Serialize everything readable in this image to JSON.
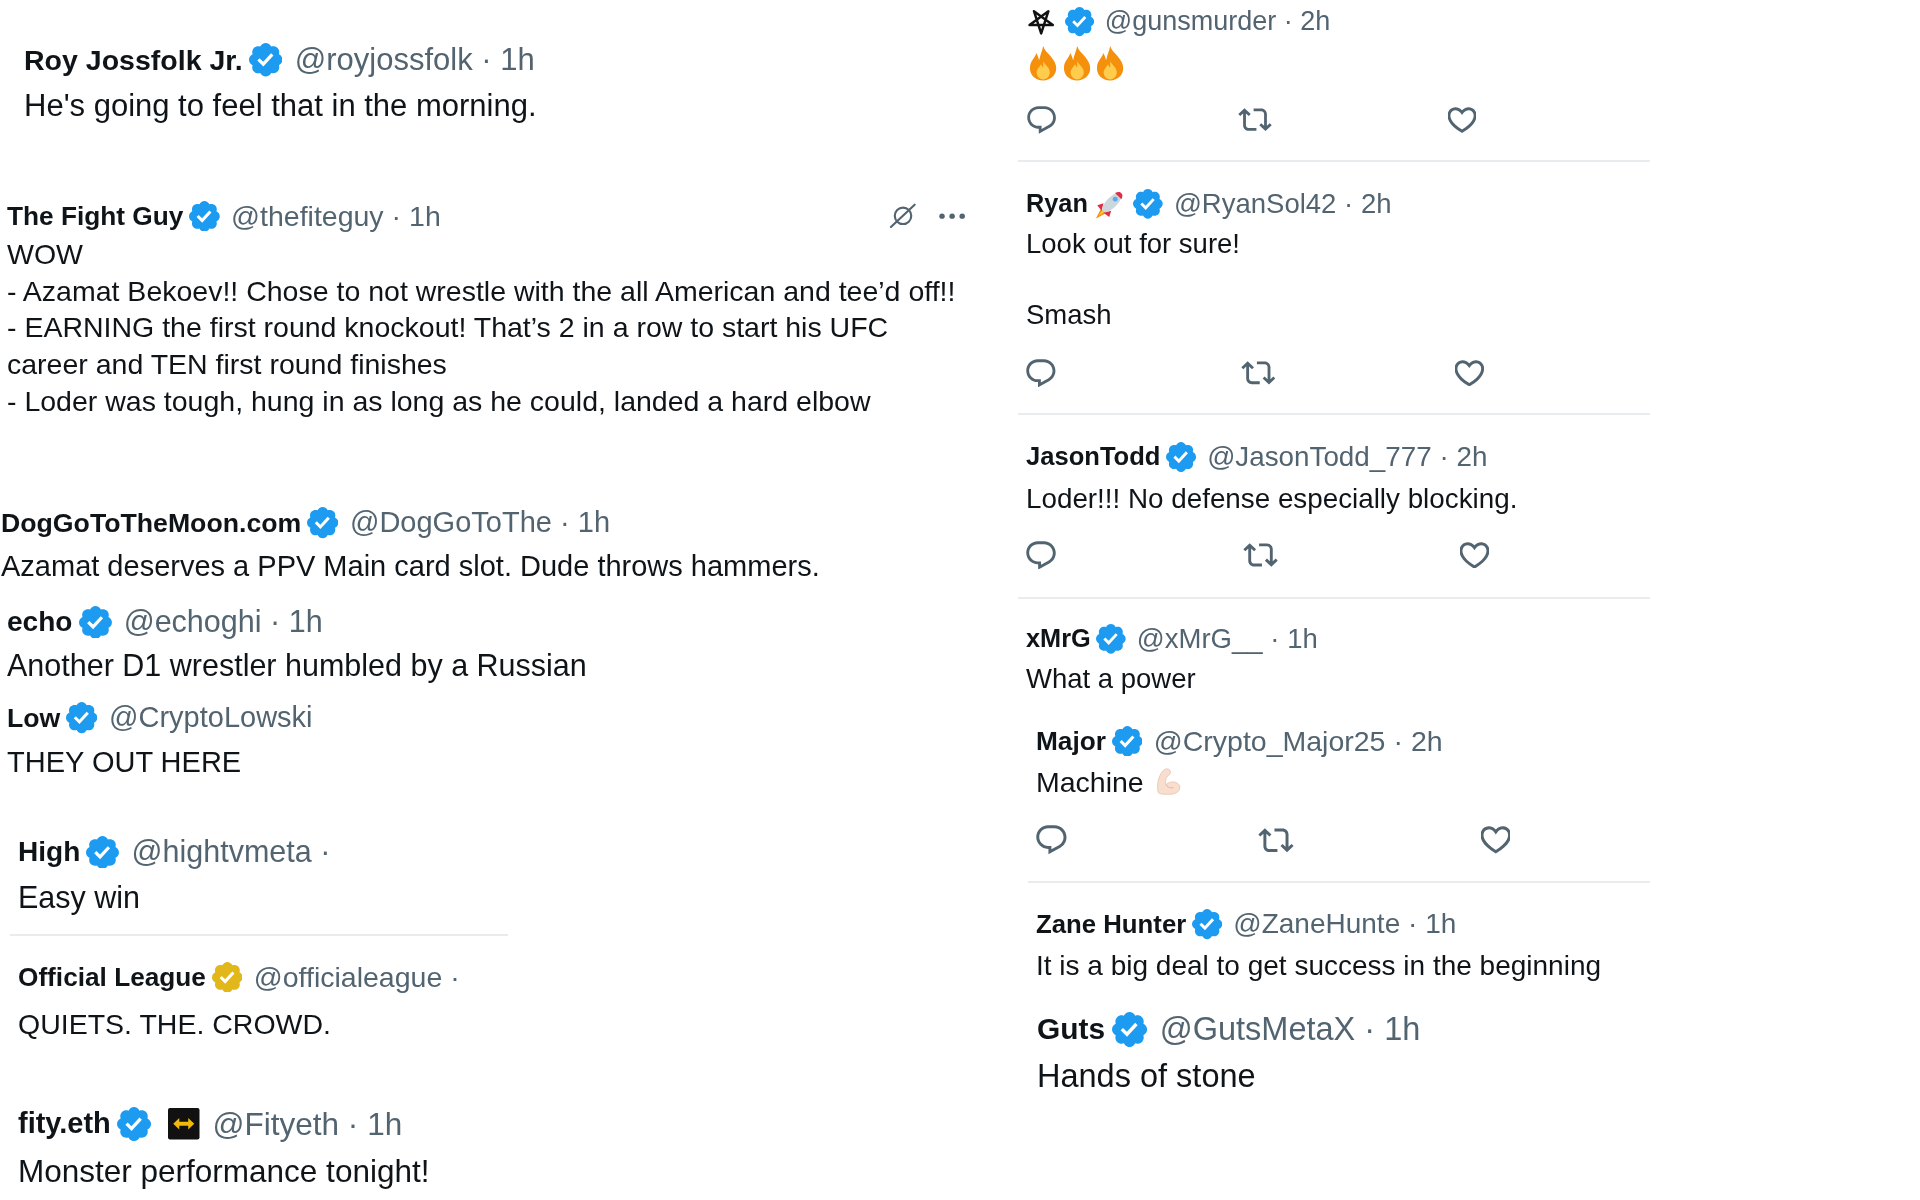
{
  "left_column": {
    "posts": [
      {
        "name": "Roy Jossfolk Jr.",
        "name_icons": [
          {
            "kind": "verified",
            "color": "#1d9bf0"
          }
        ],
        "handle": "@royjossfolk",
        "separator": "·",
        "time": "1h",
        "text": "He's going to feel that in the morning."
      },
      {
        "name": "The Fight Guy",
        "name_icons": [
          {
            "kind": "verified",
            "color": "#1d9bf0"
          }
        ],
        "handle": "@thefiteguy",
        "separator": "·",
        "time": "1h",
        "tools": [
          {
            "kind": "explain"
          },
          {
            "kind": "more"
          }
        ],
        "text": "WOW\n- Azamat Bekoev!! Chose to not wrestle with the all American and tee’d off!!\n- EARNING the first round knockout! That’s 2 in a row to start his UFC career and TEN first round finishes\n- Loder was tough, hung in as long as he could, landed a hard elbow"
      },
      {
        "name": "DogGoToTheMoon.com",
        "name_icons": [
          {
            "kind": "verified",
            "color": "#1d9bf0"
          }
        ],
        "handle": "@DogGoToThe",
        "separator": "·",
        "time": "1h",
        "text": "Azamat deserves a PPV Main card slot. Dude throws hammers."
      },
      {
        "name": "echo",
        "name_icons": [
          {
            "kind": "verified",
            "color": "#1d9bf0"
          }
        ],
        "handle": "@echoghi",
        "separator": "·",
        "time": "1h",
        "text": "Another D1 wrestler humbled by a Russian"
      },
      {
        "name": "Low",
        "name_icons": [
          {
            "kind": "verified",
            "color": "#1d9bf0"
          }
        ],
        "handle": "@CryptoLowski",
        "text": "THEY OUT HERE"
      },
      {
        "name": "High",
        "name_icons": [
          {
            "kind": "verified",
            "color": "#1d9bf0"
          }
        ],
        "handle": "@hightvmeta",
        "separator": "·",
        "text": "Easy win"
      },
      {
        "name": "Official League",
        "name_icons": [
          {
            "kind": "verified",
            "color": "#e2b719"
          }
        ],
        "handle": "@officialeague",
        "separator": "·",
        "text": "QUIETS. THE. CROWD."
      },
      {
        "name": "fity.eth",
        "name_icons": [
          {
            "kind": "verified",
            "color": "#1d9bf0"
          },
          {
            "kind": "affiliate"
          }
        ],
        "handle": "@Fityeth",
        "separator": "·",
        "time": "1h",
        "text": "Monster performance tonight!"
      }
    ]
  },
  "right_column": {
    "posts": [
      {
        "name_icons": [
          {
            "kind": "symbol"
          },
          {
            "kind": "verified",
            "color": "#1d9bf0"
          }
        ],
        "handle": "@gunsmurder",
        "separator": "·",
        "time": "2h",
        "body_icons": [
          {
            "kind": "fire"
          },
          {
            "kind": "fire"
          },
          {
            "kind": "fire"
          }
        ],
        "actions": [
          {
            "kind": "reply"
          },
          {
            "kind": "repost"
          },
          {
            "kind": "like"
          }
        ]
      },
      {
        "name": "Ryan",
        "name_icons": [
          {
            "kind": "rocket"
          },
          {
            "kind": "verified",
            "color": "#1d9bf0"
          }
        ],
        "handle": "@RyanSol42",
        "separator": "·",
        "time": "2h",
        "text": "Look out for sure!\n\nSmash",
        "actions": [
          {
            "kind": "reply"
          },
          {
            "kind": "repost"
          },
          {
            "kind": "like"
          }
        ]
      },
      {
        "name": "JasonTodd",
        "name_icons": [
          {
            "kind": "verified",
            "color": "#1d9bf0"
          }
        ],
        "handle": "@JasonTodd_777",
        "separator": "·",
        "time": "2h",
        "text": "Loder!!! No defense especially blocking.",
        "actions": [
          {
            "kind": "reply"
          },
          {
            "kind": "repost"
          },
          {
            "kind": "like"
          }
        ]
      },
      {
        "name": "xMrG",
        "name_icons": [
          {
            "kind": "verified",
            "color": "#1d9bf0"
          }
        ],
        "handle": "@xMrG__",
        "separator": "·",
        "time": "1h",
        "text": "What a power"
      },
      {
        "name": "Major",
        "name_icons": [
          {
            "kind": "verified",
            "color": "#1d9bf0"
          }
        ],
        "handle": "@Crypto_Major25",
        "separator": "·",
        "time": "2h",
        "text": "Machine",
        "body_icons": [
          {
            "kind": "biceps"
          }
        ],
        "actions": [
          {
            "kind": "reply"
          },
          {
            "kind": "repost"
          },
          {
            "kind": "like"
          }
        ]
      },
      {
        "name": "Zane Hunter",
        "name_icons": [
          {
            "kind": "verified",
            "color": "#1d9bf0"
          }
        ],
        "handle": "@ZaneHunte",
        "separator": "·",
        "time": "1h",
        "text": "It is a big deal to get success in the beginning"
      },
      {
        "name": "Guts",
        "name_icons": [
          {
            "kind": "verified",
            "color": "#1d9bf0"
          }
        ],
        "handle": "@GutsMetaX",
        "separator": "·",
        "time": "1h",
        "text": "Hands of stone"
      }
    ]
  }
}
